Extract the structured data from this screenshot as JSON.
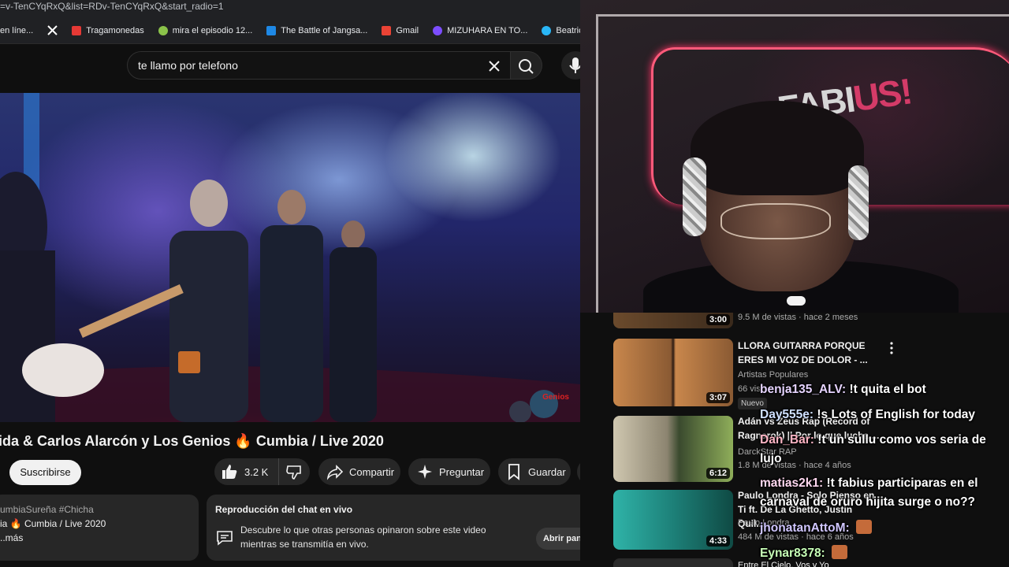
{
  "browser": {
    "url_fragment": "=v-TenCYqRxQ&list=RDv-TenCYqRxQ&start_radio=1",
    "bookmarks": [
      {
        "label": "en líne...",
        "color": "#2d6cdf"
      },
      {
        "label": "",
        "icon": "x-icon",
        "color": "#ffffff"
      },
      {
        "label": "Tragamonedas",
        "color": "#e53935"
      },
      {
        "label": "mira el episodio 12...",
        "color": "#8bc34a"
      },
      {
        "label": "The Battle of Jangsa...",
        "color": "#1e88e5"
      },
      {
        "label": "Gmail",
        "color": "#ea4335"
      },
      {
        "label": "MIZUHARA EN TO...",
        "color": "#7c4dff"
      },
      {
        "label": "Beatrice-R",
        "color": "#29b6f6"
      }
    ]
  },
  "search": {
    "query": "te llamo por telefono"
  },
  "video": {
    "title": "ida & Carlos Alarcón y Los Genios 🔥 Cumbia / Live 2020",
    "watermark": "Genios"
  },
  "actions": {
    "subscribe": "Suscribirse",
    "likes": "3.2 K",
    "share": "Compartir",
    "ask": "Preguntar",
    "save": "Guardar"
  },
  "description": {
    "line1": "umbiaSureña #Chicha",
    "line2": "ia 🔥 Cumbia / Live 2020",
    "line3": "..más"
  },
  "live_chat_card": {
    "title": "Reproducción del chat en vivo",
    "desc_line1": "Descubre lo que otras personas opinaron sobre este video",
    "desc_line2": "mientras se transmitía en vivo.",
    "open_button": "Abrir panel"
  },
  "recommendations": [
    {
      "title": "",
      "meta1": "9.5 M de vistas · hace 2 meses",
      "duration": "3:00"
    },
    {
      "title_line1": "LLORA GUITARRA PORQUE",
      "title_line2": "ERES MI VOZ DE DOLOR - ...",
      "channel": "Artistas Populares",
      "meta1": "66 vis",
      "badge": "Nuevo",
      "duration": "3:07"
    },
    {
      "title_line1": "Adán vs Zeus Rap (Record of",
      "title_line2": "Ragnarok) || Por lo que lucha ...",
      "channel": "DarckStar RAP",
      "meta1": "1.8 M de vistas · hace 4 años",
      "duration": "6:12"
    },
    {
      "title_line1": "Paulo Londra - Solo Pienso en",
      "title_line2": "Ti ft. De La Ghetto, Justin Quil...",
      "channel": "Paulo Londra",
      "meta1": "484 M de vistas · hace 6 años",
      "duration": "4:33"
    },
    {
      "title_line1": "Entre El Cielo, Vos y Yo"
    }
  ],
  "stream_chat": [
    {
      "user": "benja135_ALV:",
      "text": "!t quita el bot"
    },
    {
      "user": "Day555e:",
      "text": "!s Lots of English for today"
    },
    {
      "user": "Dan_Bar:",
      "text": "!t un sullu como vos seria de",
      "text2": "lujo"
    },
    {
      "user": "matias2k1:",
      "text": "!t fabius participaras en el",
      "text2": "carnaval de oruro hijita surge o no??"
    },
    {
      "user": "jhonatanAttoM:",
      "text": ""
    },
    {
      "user": "Eynar8378:",
      "text": ""
    }
  ],
  "cam": {
    "logo_a": "FABI",
    "logo_b": "US!"
  }
}
